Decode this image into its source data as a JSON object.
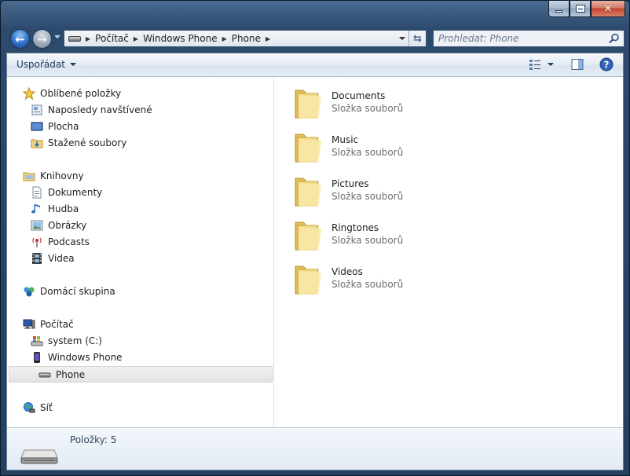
{
  "window": {
    "caption": {
      "minimize": "▁",
      "maximize": "□",
      "close": "✕"
    }
  },
  "address": {
    "crumbs": [
      "Počítač",
      "Windows Phone",
      "Phone"
    ]
  },
  "search": {
    "placeholder": "Prohledat: Phone"
  },
  "toolbar": {
    "organize_label": "Uspořádat"
  },
  "navpane": {
    "favorites": {
      "label": "Oblíbené položky",
      "items": [
        "Naposledy navštívené",
        "Plocha",
        "Stažené soubory"
      ]
    },
    "libraries": {
      "label": "Knihovny",
      "items": [
        "Dokumenty",
        "Hudba",
        "Obrázky",
        "Podcasts",
        "Videa"
      ]
    },
    "homegroup": {
      "label": "Domácí skupina"
    },
    "computer": {
      "label": "Počítač",
      "items": [
        "system (C:)",
        "Windows Phone",
        "Phone"
      ],
      "selected": "Phone"
    },
    "network": {
      "label": "Síť"
    }
  },
  "files": [
    {
      "name": "Documents",
      "type": "Složka souborů"
    },
    {
      "name": "Music",
      "type": "Složka souborů"
    },
    {
      "name": "Pictures",
      "type": "Složka souborů"
    },
    {
      "name": "Ringtones",
      "type": "Složka souborů"
    },
    {
      "name": "Videos",
      "type": "Složka souborů"
    }
  ],
  "details": {
    "item_count": "Položky: 5"
  },
  "colors": {
    "accent": "#2f6fc4",
    "folder": "#f2d57a",
    "frame_bg": "#22405f"
  }
}
